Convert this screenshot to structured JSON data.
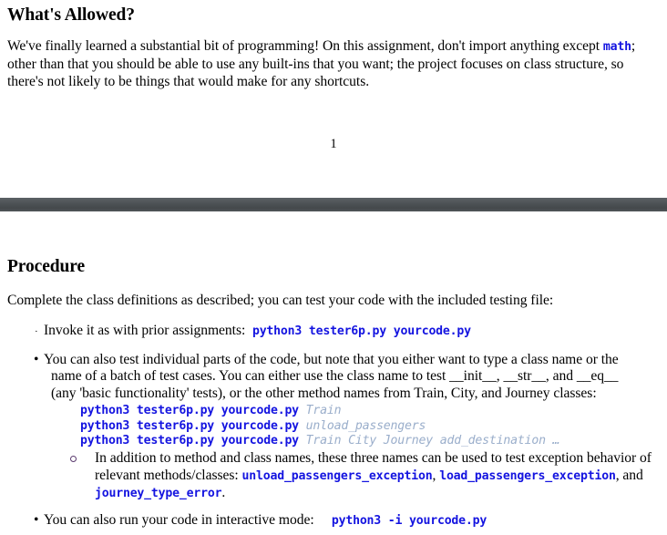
{
  "document": {
    "page_number": "1"
  },
  "section_allowed": {
    "heading": "What's Allowed?",
    "paragraph_part1": "We've finally learned a substantial bit of programming! On this assignment, don't import anything except ",
    "paragraph_code_math": "math",
    "paragraph_part2": "; other than that you should be able to use any built-ins that you want; the project focuses on class structure, so there's not likely to be things that would make for any shortcuts."
  },
  "section_procedure": {
    "heading": "Procedure",
    "intro": "Complete the class definitions as described; you can test your code with the included testing file:",
    "bullet1": {
      "marker": "·",
      "text": "Invoke it as with prior assignments:",
      "code": "python3 tester6p.py yourcode.py"
    },
    "bullet2": {
      "marker": "•",
      "text_line1": "You can also test individual parts of the code, but note that you either want to type a class name or the",
      "text_line2_a": "name of a batch of test cases. You can either use the class name to test ",
      "text_line2_dunder1": "__init__",
      "text_line2_sep1": ", ",
      "text_line2_dunder2": "__str__",
      "text_line2_sep2": ", and ",
      "text_line2_dunder3": "__eq__",
      "text_line3": "(any 'basic functionality' tests), or the other method names from Train, City, and Journey classes:",
      "code_lines": [
        {
          "command": "python3 tester6p.py yourcode.py ",
          "args": "Train"
        },
        {
          "command": "python3 tester6p.py yourcode.py ",
          "args": "unload_passengers"
        },
        {
          "command": "python3 tester6p.py yourcode.py ",
          "args": "Train City Journey add_destination …"
        }
      ],
      "subbullet": {
        "text_a": "In addition to method and class names, these three names can be used to test exception behavior of relevant methods/classes: ",
        "code1": "unload_passengers_exception",
        "sep1": ", ",
        "code2": "load_passengers_exception",
        "sep2": ", and ",
        "code3": "journey_type_error",
        "sep3": "."
      }
    },
    "bullet3": {
      "marker": "•",
      "text": "You can also run your code in interactive mode:",
      "code": "python3 -i yourcode.py"
    }
  },
  "colors": {
    "code_blue": "#1414e0",
    "code_arg_gray_blue": "#9aaecb",
    "divider_gray": "#4e5356",
    "text_black": "#000000"
  }
}
